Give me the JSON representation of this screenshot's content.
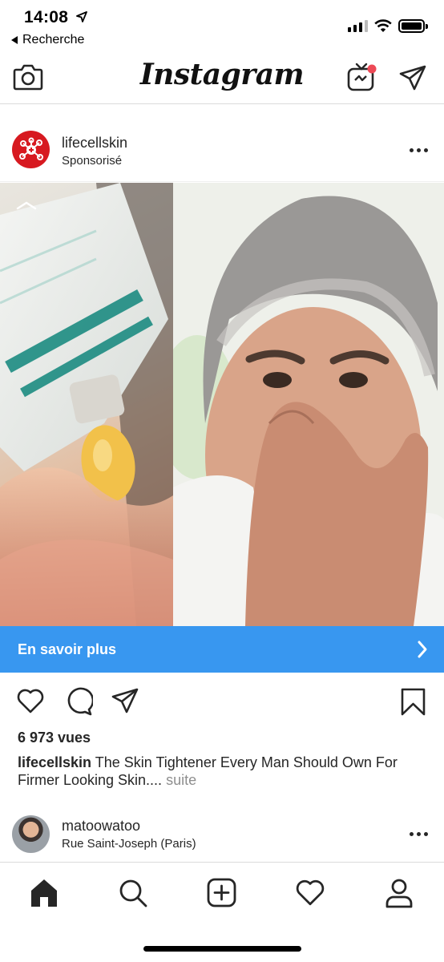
{
  "status_bar": {
    "time": "14:08",
    "back_label": "Recherche",
    "icons": [
      "location-arrow-icon",
      "signal-bars-icon",
      "wifi-icon",
      "battery-icon"
    ]
  },
  "header": {
    "app_name": "Instagram",
    "left_icon": "camera-icon",
    "right_icons": [
      "igtv-icon",
      "direct-message-icon"
    ],
    "notification_color": "#ed4956"
  },
  "post": {
    "username": "lifecellskin",
    "sponsored_label": "Sponsorisé",
    "avatar_color": "#d71920",
    "cta_label": "En savoir plus",
    "cta_color": "#3897f0",
    "views": "6 973 vues",
    "caption_user": "lifecellskin",
    "caption_text": " The Skin Tightener Every Man Should Own For Firmer Looking Skin....",
    "caption_more": " suite",
    "action_icons": [
      "like-icon",
      "comment-icon",
      "share-icon",
      "bookmark-icon"
    ]
  },
  "next_post": {
    "username": "matoowatoo",
    "location": "Rue Saint-Joseph (Paris)"
  },
  "tab_bar": {
    "items": [
      "home-icon",
      "search-icon",
      "new-post-icon",
      "activity-icon",
      "profile-icon"
    ]
  }
}
